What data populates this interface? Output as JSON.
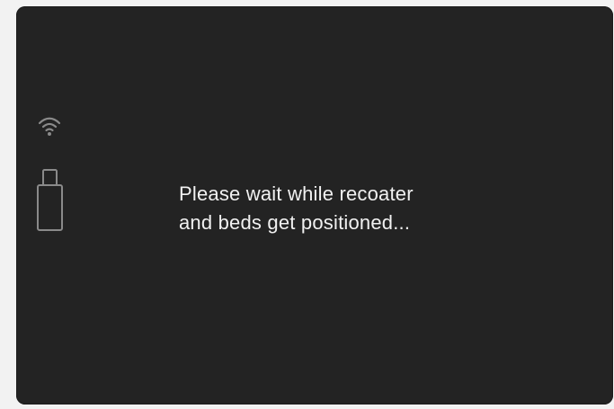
{
  "screen": {
    "message": "Please wait while recoater\nand beds get positioned..."
  },
  "status": {
    "wifi_icon": "wifi-icon",
    "usb_icon": "usb-drive-icon"
  },
  "colors": {
    "panel_background": "#232323",
    "outer_background": "#f2f2f2",
    "text": "#f1f1f1",
    "icon_stroke": "#8a8a8a"
  }
}
